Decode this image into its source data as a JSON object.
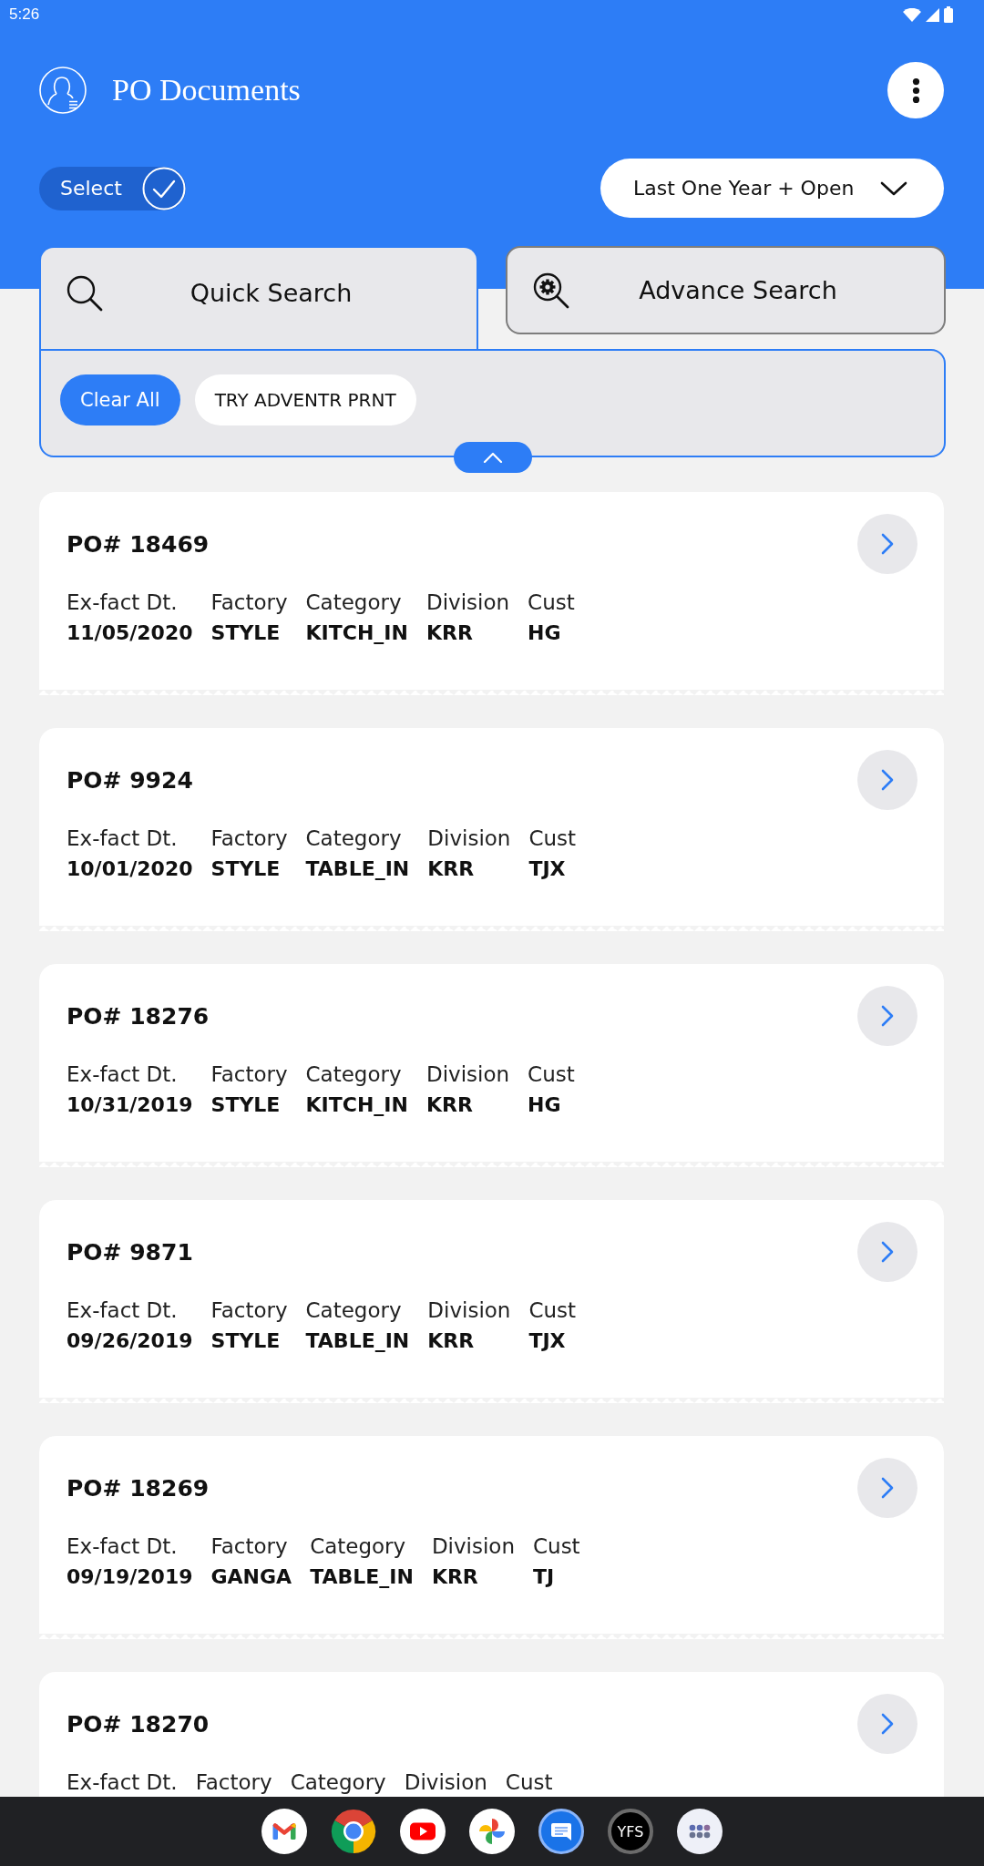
{
  "status_bar": {
    "time": "5:26"
  },
  "app_bar": {
    "title": "PO Documents"
  },
  "filter_bar": {
    "select_label": "Select",
    "period": "Last One Year + Open"
  },
  "search_tabs": [
    {
      "kind": "quick",
      "label": "Quick Search",
      "selected": true
    },
    {
      "kind": "advanced",
      "label": "Advance Search",
      "selected": false
    }
  ],
  "filters": {
    "clear_label": "Clear All",
    "chips": [
      "TRY ADVENTR PRNT"
    ],
    "expanded": true
  },
  "po_cards": [
    {
      "title": "PO# 18469",
      "fields": [
        {
          "label": "Ex-fact Dt.",
          "value": "11/05/2020"
        },
        {
          "label": "Factory",
          "value": "STYLE"
        },
        {
          "label": "Category",
          "value": "KITCH_IN"
        },
        {
          "label": "Division",
          "value": "KRR"
        },
        {
          "label": "Cust",
          "value": "HG"
        }
      ]
    },
    {
      "title": "PO# 9924",
      "fields": [
        {
          "label": "Ex-fact Dt.",
          "value": "10/01/2020"
        },
        {
          "label": "Factory",
          "value": "STYLE"
        },
        {
          "label": "Category",
          "value": "TABLE_IN"
        },
        {
          "label": "Division",
          "value": "KRR"
        },
        {
          "label": "Cust",
          "value": "TJX"
        }
      ]
    },
    {
      "title": "PO# 18276",
      "fields": [
        {
          "label": "Ex-fact Dt.",
          "value": "10/31/2019"
        },
        {
          "label": "Factory",
          "value": "STYLE"
        },
        {
          "label": "Category",
          "value": "KITCH_IN"
        },
        {
          "label": "Division",
          "value": "KRR"
        },
        {
          "label": "Cust",
          "value": "HG"
        }
      ]
    },
    {
      "title": "PO# 9871",
      "fields": [
        {
          "label": "Ex-fact Dt.",
          "value": "09/26/2019"
        },
        {
          "label": "Factory",
          "value": "STYLE"
        },
        {
          "label": "Category",
          "value": "TABLE_IN"
        },
        {
          "label": "Division",
          "value": "KRR"
        },
        {
          "label": "Cust",
          "value": "TJX"
        }
      ]
    },
    {
      "title": "PO# 18269",
      "fields": [
        {
          "label": "Ex-fact Dt.",
          "value": "09/19/2019"
        },
        {
          "label": "Factory",
          "value": "GANGA"
        },
        {
          "label": "Category",
          "value": "TABLE_IN"
        },
        {
          "label": "Division",
          "value": "KRR"
        },
        {
          "label": "Cust",
          "value": "TJ"
        }
      ]
    },
    {
      "title": "PO# 18270",
      "fields": [
        {
          "label": "Ex-fact Dt."
        },
        {
          "label": "Factory"
        },
        {
          "label": "Category"
        },
        {
          "label": "Division"
        },
        {
          "label": "Cust"
        }
      ]
    }
  ],
  "nav_bar": {
    "labeled_app": "YFS"
  }
}
